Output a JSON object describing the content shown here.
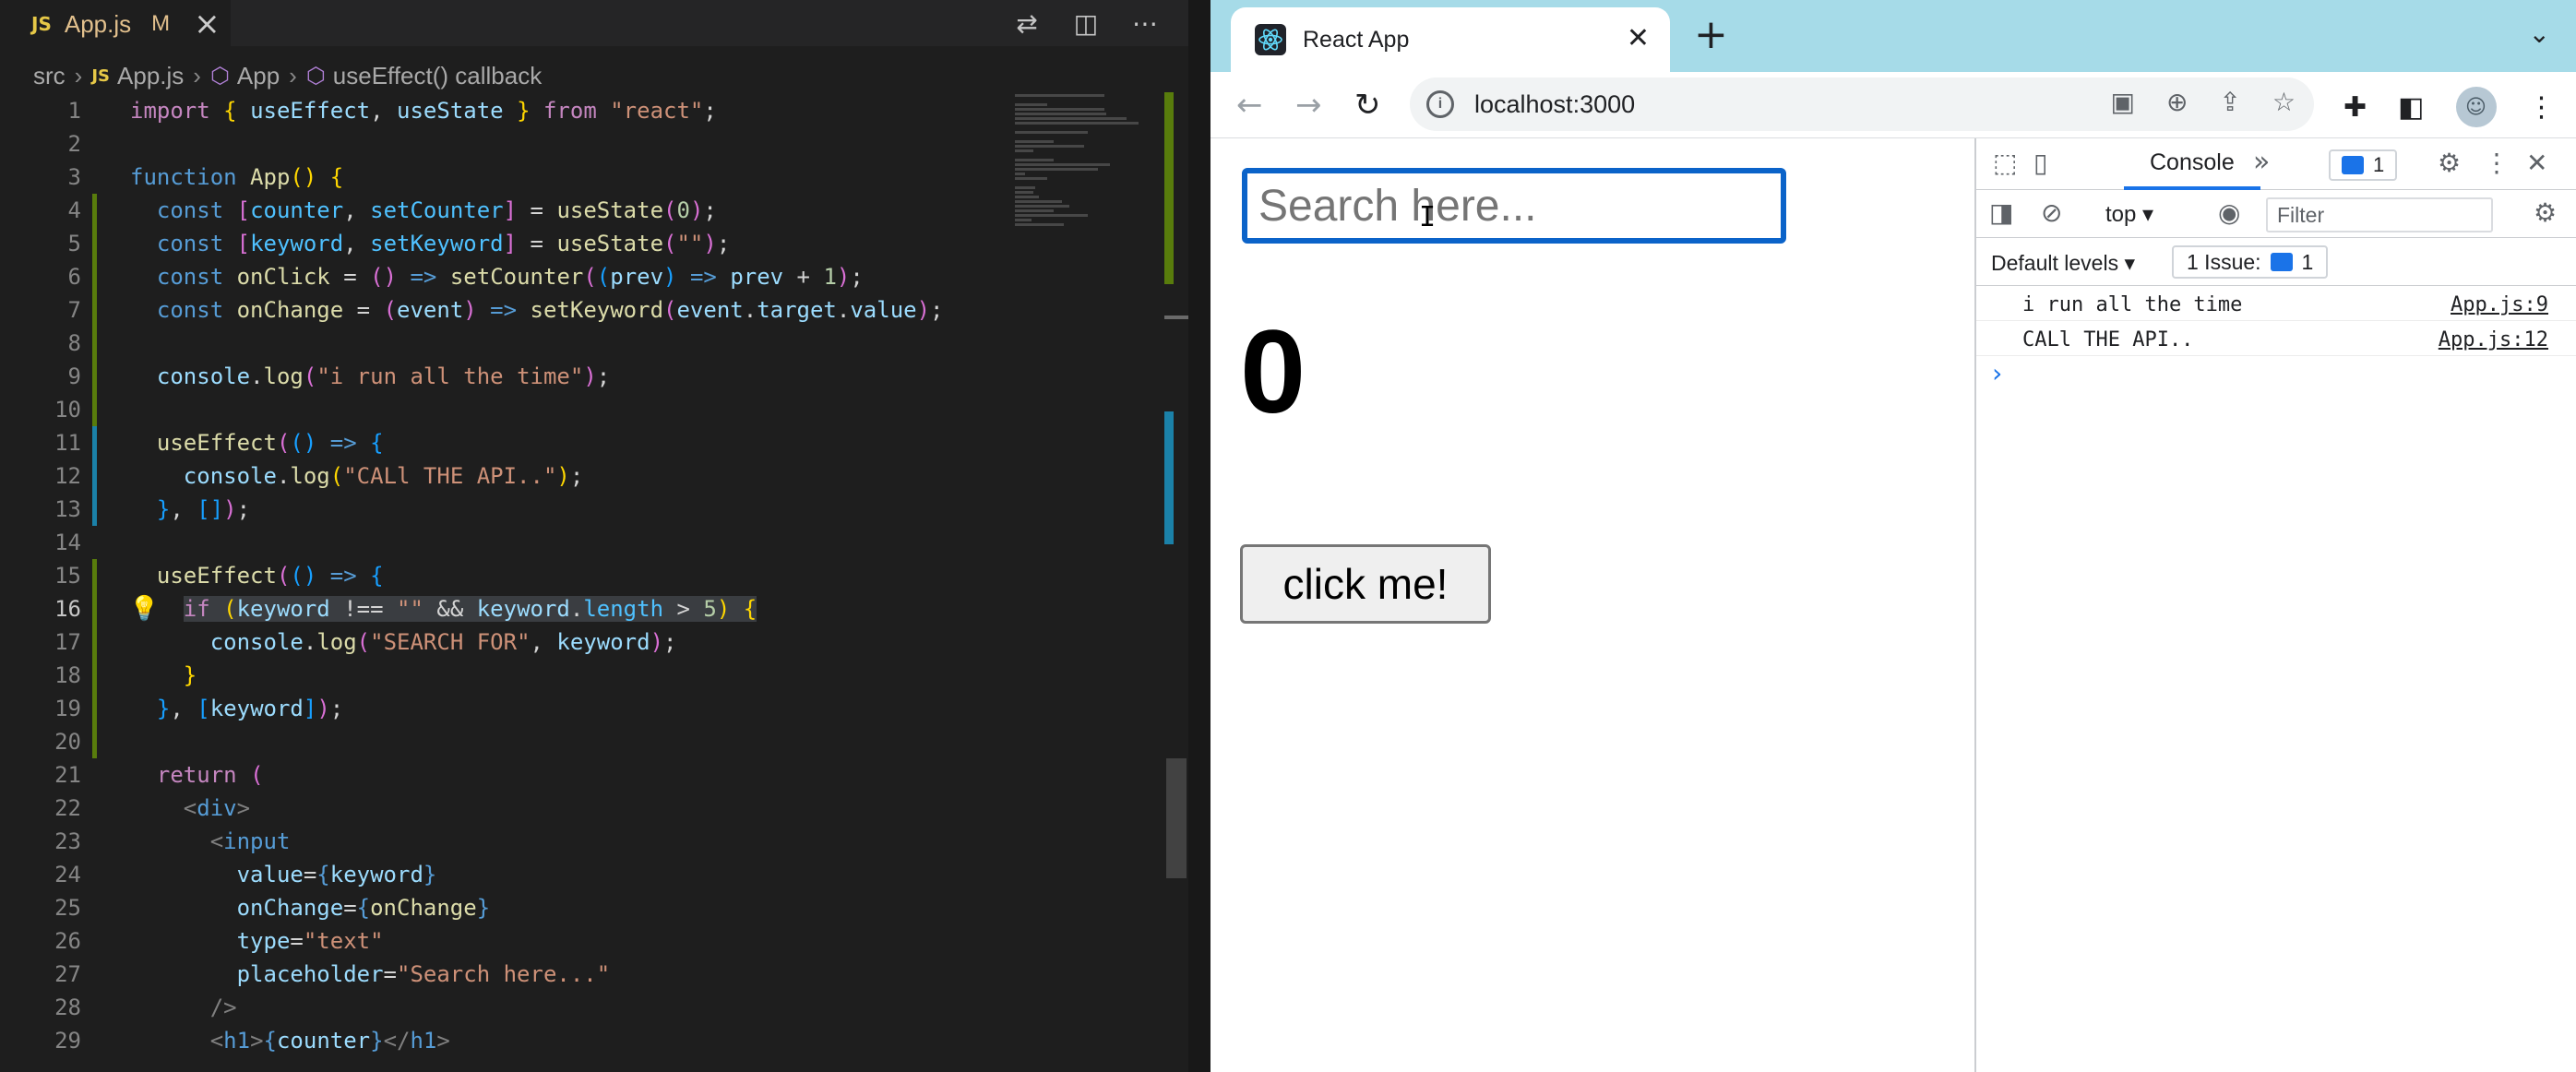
{
  "vscode": {
    "tab": {
      "icon_label": "JS",
      "filename": "App.js",
      "modified": "M"
    },
    "breadcrumb": [
      "src",
      "App.js",
      "App",
      "useEffect() callback"
    ],
    "active_line": 16,
    "code_lines": [
      [
        [
          "kw",
          "import"
        ],
        [
          "pn",
          " "
        ],
        [
          "br1",
          "{"
        ],
        [
          "pn",
          " "
        ],
        [
          "var",
          "useEffect"
        ],
        [
          "pn",
          ", "
        ],
        [
          "var",
          "useState"
        ],
        [
          "pn",
          " "
        ],
        [
          "br1",
          "}"
        ],
        [
          "pn",
          " "
        ],
        [
          "kw",
          "from"
        ],
        [
          "pn",
          " "
        ],
        [
          "str",
          "\"react\""
        ],
        [
          "pn",
          ";"
        ]
      ],
      [],
      [
        [
          "st",
          "function"
        ],
        [
          "pn",
          " "
        ],
        [
          "fn",
          "App"
        ],
        [
          "br1",
          "()"
        ],
        [
          "pn",
          " "
        ],
        [
          "br1",
          "{"
        ]
      ],
      [
        [
          "pn",
          "  "
        ],
        [
          "st",
          "const"
        ],
        [
          "pn",
          " "
        ],
        [
          "br2",
          "["
        ],
        [
          "con",
          "counter"
        ],
        [
          "pn",
          ", "
        ],
        [
          "con",
          "setCounter"
        ],
        [
          "br2",
          "]"
        ],
        [
          "pn",
          " = "
        ],
        [
          "fn",
          "useState"
        ],
        [
          "br2",
          "("
        ],
        [
          "num",
          "0"
        ],
        [
          "br2",
          ")"
        ],
        [
          "pn",
          ";"
        ]
      ],
      [
        [
          "pn",
          "  "
        ],
        [
          "st",
          "const"
        ],
        [
          "pn",
          " "
        ],
        [
          "br2",
          "["
        ],
        [
          "con",
          "keyword"
        ],
        [
          "pn",
          ", "
        ],
        [
          "con",
          "setKeyword"
        ],
        [
          "br2",
          "]"
        ],
        [
          "pn",
          " = "
        ],
        [
          "fn",
          "useState"
        ],
        [
          "br2",
          "("
        ],
        [
          "str",
          "\"\""
        ],
        [
          "br2",
          ")"
        ],
        [
          "pn",
          ";"
        ]
      ],
      [
        [
          "pn",
          "  "
        ],
        [
          "st",
          "const"
        ],
        [
          "pn",
          " "
        ],
        [
          "fn",
          "onClick"
        ],
        [
          "pn",
          " = "
        ],
        [
          "br2",
          "()"
        ],
        [
          "pn",
          " "
        ],
        [
          "st",
          "=>"
        ],
        [
          "pn",
          " "
        ],
        [
          "fn",
          "setCounter"
        ],
        [
          "br2",
          "("
        ],
        [
          "br3",
          "("
        ],
        [
          "var",
          "prev"
        ],
        [
          "br3",
          ")"
        ],
        [
          "pn",
          " "
        ],
        [
          "st",
          "=>"
        ],
        [
          "pn",
          " "
        ],
        [
          "var",
          "prev"
        ],
        [
          "pn",
          " + "
        ],
        [
          "num",
          "1"
        ],
        [
          "br2",
          ")"
        ],
        [
          "pn",
          ";"
        ]
      ],
      [
        [
          "pn",
          "  "
        ],
        [
          "st",
          "const"
        ],
        [
          "pn",
          " "
        ],
        [
          "fn",
          "onChange"
        ],
        [
          "pn",
          " = "
        ],
        [
          "br2",
          "("
        ],
        [
          "var",
          "event"
        ],
        [
          "br2",
          ")"
        ],
        [
          "pn",
          " "
        ],
        [
          "st",
          "=>"
        ],
        [
          "pn",
          " "
        ],
        [
          "fn",
          "setKeyword"
        ],
        [
          "br2",
          "("
        ],
        [
          "var",
          "event"
        ],
        [
          "pn",
          "."
        ],
        [
          "var",
          "target"
        ],
        [
          "pn",
          "."
        ],
        [
          "var",
          "value"
        ],
        [
          "br2",
          ")"
        ],
        [
          "pn",
          ";"
        ]
      ],
      [],
      [
        [
          "pn",
          "  "
        ],
        [
          "var",
          "console"
        ],
        [
          "pn",
          "."
        ],
        [
          "fn",
          "log"
        ],
        [
          "br2",
          "("
        ],
        [
          "str",
          "\"i run all the time\""
        ],
        [
          "br2",
          ")"
        ],
        [
          "pn",
          ";"
        ]
      ],
      [],
      [
        [
          "pn",
          "  "
        ],
        [
          "fn",
          "useEffect"
        ],
        [
          "br2",
          "("
        ],
        [
          "br3",
          "()"
        ],
        [
          "pn",
          " "
        ],
        [
          "st",
          "=>"
        ],
        [
          "pn",
          " "
        ],
        [
          "br3",
          "{"
        ]
      ],
      [
        [
          "pn",
          "    "
        ],
        [
          "var",
          "console"
        ],
        [
          "pn",
          "."
        ],
        [
          "fn",
          "log"
        ],
        [
          "br1",
          "("
        ],
        [
          "str",
          "\"CALl THE API..\""
        ],
        [
          "br1",
          ")"
        ],
        [
          "pn",
          ";"
        ]
      ],
      [
        [
          "pn",
          "  "
        ],
        [
          "br3",
          "}"
        ],
        [
          "pn",
          ", "
        ],
        [
          "br3",
          "[]"
        ],
        [
          "br2",
          ")"
        ],
        [
          "pn",
          ";"
        ]
      ],
      [],
      [
        [
          "pn",
          "  "
        ],
        [
          "fn",
          "useEffect"
        ],
        [
          "br2",
          "("
        ],
        [
          "br3",
          "()"
        ],
        [
          "pn",
          " "
        ],
        [
          "st",
          "=>"
        ],
        [
          "pn",
          " "
        ],
        [
          "br3",
          "{"
        ]
      ],
      [
        [
          "pn",
          "    "
        ],
        [
          "kw",
          "if"
        ],
        [
          "pn",
          " "
        ],
        [
          "br1",
          "("
        ],
        [
          "var",
          "keyword"
        ],
        [
          "pn",
          " !== "
        ],
        [
          "str",
          "\"\""
        ],
        [
          "pn",
          " && "
        ],
        [
          "var",
          "keyword"
        ],
        [
          "pn",
          "."
        ],
        [
          "con",
          "length"
        ],
        [
          "pn",
          " > "
        ],
        [
          "num",
          "5"
        ],
        [
          "br1",
          ")"
        ],
        [
          "pn",
          " "
        ],
        [
          "br1",
          "{"
        ]
      ],
      [
        [
          "pn",
          "      "
        ],
        [
          "var",
          "console"
        ],
        [
          "pn",
          "."
        ],
        [
          "fn",
          "log"
        ],
        [
          "br2",
          "("
        ],
        [
          "str",
          "\"SEARCH FOR\""
        ],
        [
          "pn",
          ", "
        ],
        [
          "var",
          "keyword"
        ],
        [
          "br2",
          ")"
        ],
        [
          "pn",
          ";"
        ]
      ],
      [
        [
          "pn",
          "    "
        ],
        [
          "br1",
          "}"
        ]
      ],
      [
        [
          "pn",
          "  "
        ],
        [
          "br3",
          "}"
        ],
        [
          "pn",
          ", "
        ],
        [
          "br3",
          "["
        ],
        [
          "var",
          "keyword"
        ],
        [
          "br3",
          "]"
        ],
        [
          "br2",
          ")"
        ],
        [
          "pn",
          ";"
        ]
      ],
      [],
      [
        [
          "pn",
          "  "
        ],
        [
          "kw",
          "return"
        ],
        [
          "pn",
          " "
        ],
        [
          "br2",
          "("
        ]
      ],
      [
        [
          "pn",
          "    "
        ],
        [
          "cmt",
          "<"
        ],
        [
          "tgn",
          "div"
        ],
        [
          "cmt",
          ">"
        ]
      ],
      [
        [
          "pn",
          "      "
        ],
        [
          "cmt",
          "<"
        ],
        [
          "tgn",
          "input"
        ]
      ],
      [
        [
          "pn",
          "        "
        ],
        [
          "attr",
          "value"
        ],
        [
          "pn",
          "="
        ],
        [
          "st",
          "{"
        ],
        [
          "var",
          "keyword"
        ],
        [
          "st",
          "}"
        ]
      ],
      [
        [
          "pn",
          "        "
        ],
        [
          "attr",
          "onChange"
        ],
        [
          "pn",
          "="
        ],
        [
          "st",
          "{"
        ],
        [
          "fn",
          "onChange"
        ],
        [
          "st",
          "}"
        ]
      ],
      [
        [
          "pn",
          "        "
        ],
        [
          "attr",
          "type"
        ],
        [
          "pn",
          "="
        ],
        [
          "str",
          "\"text\""
        ]
      ],
      [
        [
          "pn",
          "        "
        ],
        [
          "attr",
          "placeholder"
        ],
        [
          "pn",
          "="
        ],
        [
          "str",
          "\"Search here...\""
        ]
      ],
      [
        [
          "pn",
          "      "
        ],
        [
          "cmt",
          "/>"
        ]
      ],
      [
        [
          "pn",
          "      "
        ],
        [
          "cmt",
          "<"
        ],
        [
          "tgn",
          "h1"
        ],
        [
          "cmt",
          ">"
        ],
        [
          "st",
          "{"
        ],
        [
          "var",
          "counter"
        ],
        [
          "st",
          "}"
        ],
        [
          "cmt",
          "</"
        ],
        [
          "tgn",
          "h1"
        ],
        [
          "cmt",
          ">"
        ]
      ]
    ],
    "gutter_markers": {
      "added": [
        4,
        5,
        6,
        7,
        8,
        9,
        10
      ],
      "modified": [
        11,
        12,
        13
      ],
      "added2": [
        15,
        16,
        17,
        18,
        19,
        20
      ],
      "hatched": [
        22,
        23,
        24,
        25,
        26,
        27,
        28,
        29
      ]
    }
  },
  "browser": {
    "tab_title": "React App",
    "url": "localhost:3000",
    "page": {
      "search_placeholder": "Search here...",
      "counter": "0",
      "button_label": "click me!"
    },
    "devtools": {
      "active_tab": "Console",
      "messages_badge": "1",
      "context": "top",
      "filter_placeholder": "Filter",
      "levels_label": "Default levels",
      "issues_label": "1 Issue:",
      "issues_count": "1",
      "logs": [
        {
          "message": "i run all the time",
          "source": "App.js:9"
        },
        {
          "message": "CALl THE API..",
          "source": "App.js:12"
        }
      ]
    }
  },
  "colors": {
    "vscode_bg": "#1e1e1e",
    "chrome_tabstrip": "#a6dbe8",
    "focus_ring": "#0b63c9"
  }
}
